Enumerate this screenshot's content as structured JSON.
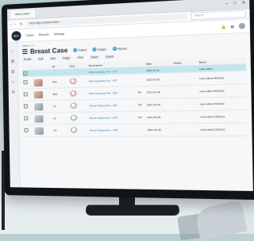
{
  "browser": {
    "tab_title": "Inbox | BCC",
    "url": "https://app.example/cases",
    "search_placeholder": "Search",
    "window_controls": [
      "–",
      "□",
      "✕"
    ]
  },
  "app": {
    "logo_text": "BCC",
    "nav": [
      "Cases",
      "Reports",
      "Settings"
    ],
    "user_initial": ""
  },
  "page": {
    "breadcrumb": "Cases / 4",
    "title": "Breast Case",
    "stats": [
      {
        "badge": "1",
        "label": "Patient"
      },
      {
        "badge": "2",
        "label": "Images"
      },
      {
        "badge": "3",
        "label": "Reports"
      }
    ],
    "toolbar": [
      "Profile",
      "Edit",
      "Add",
      "Image",
      "Print",
      "Share",
      "Export"
    ]
  },
  "table": {
    "headers": [
      "",
      "",
      "ID",
      "View",
      "Description",
      "",
      "Date",
      "Status",
      "",
      "Notes"
    ],
    "selected_row": {
      "id": "",
      "description": "Mammography Hip - Left",
      "date": "2021-01-11",
      "notes": "Last edited"
    },
    "rows": [
      {
        "id": "R01",
        "view": "CC-Lat",
        "description": "Mammography Hip - ART",
        "flag": "",
        "date": "2021-01-01",
        "notes": "Last edited 08/01/21",
        "thumb": "color",
        "scan": "pink"
      },
      {
        "id": "R02",
        "view": "CC-Lat",
        "description": "Mammography Hip - ART",
        "flag": "TM",
        "date": "2021-01-03",
        "notes": "Last edited 08/01/21",
        "thumb": "color",
        "scan": "pink"
      },
      {
        "id": "C1",
        "view": "CC-Lat",
        "description": "Breast Diagnostics - ART",
        "flag": "TM",
        "date": "2021-01-05",
        "notes": "Last edited 09/01/21",
        "thumb": "gray",
        "scan": "gray"
      },
      {
        "id": "C2",
        "view": "CC-Lat",
        "description": "Breast Diagnostics - ART",
        "flag": "TM",
        "date": "2021-01-06",
        "notes": "Last edited 09/01/21",
        "thumb": "gray",
        "scan": "gray"
      },
      {
        "id": "C3",
        "view": "CC-Lat",
        "description": "Breast Diagnostics - ART",
        "flag": "",
        "date": "2021-01-08",
        "notes": "Last edited 10/01/21",
        "thumb": "gray",
        "scan": "gray"
      }
    ]
  }
}
